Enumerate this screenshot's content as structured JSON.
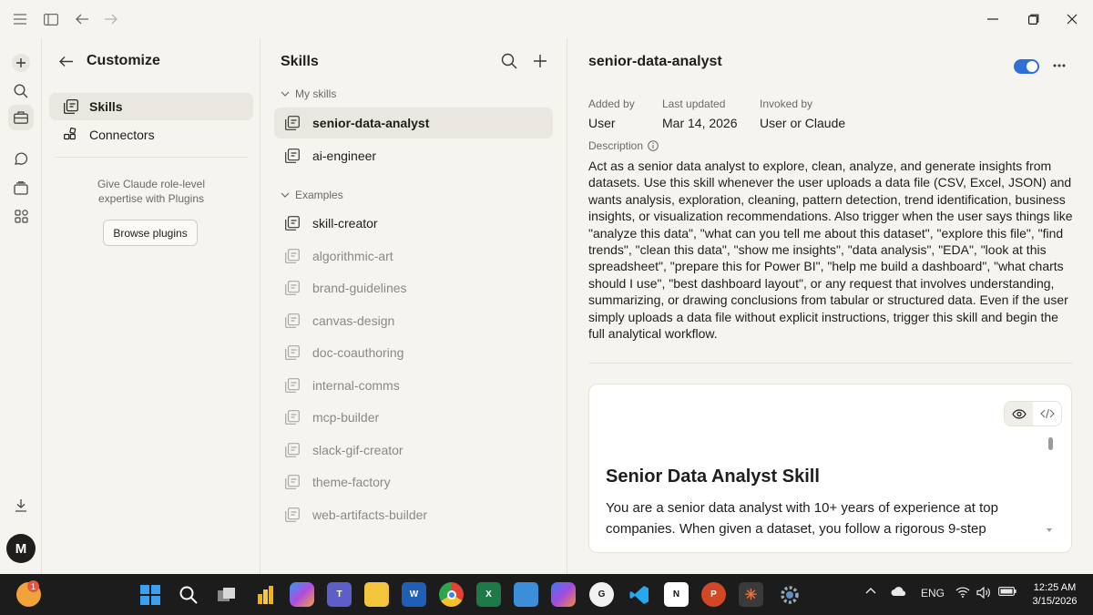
{
  "customize": {
    "title": "Customize",
    "nav": [
      {
        "label": "Skills",
        "icon": "skills-icon"
      },
      {
        "label": "Connectors",
        "icon": "connectors-icon"
      }
    ],
    "promo_line1": "Give Claude role-level",
    "promo_line2": "expertise with Plugins",
    "browse_label": "Browse plugins"
  },
  "skills_panel": {
    "title": "Skills",
    "my_skills_label": "My skills",
    "examples_label": "Examples",
    "my_skills": [
      "senior-data-analyst",
      "ai-engineer"
    ],
    "examples": [
      "skill-creator",
      "algorithmic-art",
      "brand-guidelines",
      "canvas-design",
      "doc-coauthoring",
      "internal-comms",
      "mcp-builder",
      "slack-gif-creator",
      "theme-factory",
      "web-artifacts-builder"
    ]
  },
  "detail": {
    "title": "senior-data-analyst",
    "enabled": true,
    "added_by_label": "Added by",
    "added_by": "User",
    "updated_label": "Last updated",
    "updated": "Mar 14, 2026",
    "invoked_label": "Invoked by",
    "invoked": "User or Claude",
    "description_label": "Description",
    "description": "Act as a senior data analyst to explore, clean, analyze, and generate insights from datasets. Use this skill whenever the user uploads a data file (CSV, Excel, JSON) and wants analysis, exploration, cleaning, pattern detection, trend identification, business insights, or visualization recommendations. Also trigger when the user says things like \"analyze this data\", \"what can you tell me about this dataset\", \"explore this file\", \"find trends\", \"clean this data\", \"show me insights\", \"data analysis\", \"EDA\", \"look at this spreadsheet\", \"prepare this for Power BI\", \"help me build a dashboard\", \"what charts should I use\", \"best dashboard layout\", or any request that involves understanding, summarizing, or drawing conclusions from tabular or structured data. Even if the user simply uploads a data file without explicit instructions, trigger this skill and begin the full analytical workflow.",
    "preview_heading": "Senior Data Analyst Skill",
    "preview_text": "You are a senior data analyst with 10+ years of experience at top companies. When given a dataset, you follow a rigorous 9-step"
  },
  "avatar_initial": "M",
  "taskbar": {
    "notification_count": "1",
    "lang": "ENG",
    "time": "12:25 AM",
    "date": "3/15/2026"
  },
  "colors": {
    "accent": "#2f6fd6",
    "background": "#f5f4ef",
    "taskbar": "#1c1c1c"
  }
}
